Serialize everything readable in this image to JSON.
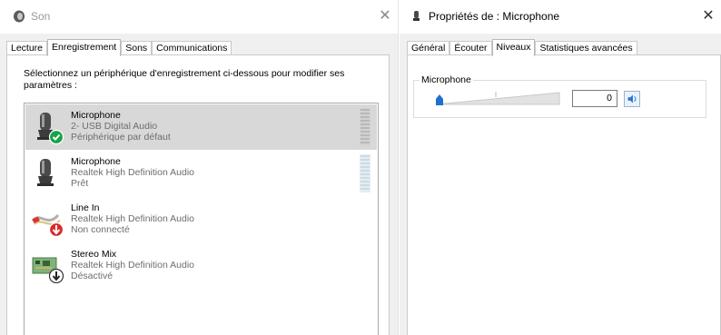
{
  "left_window": {
    "title": "Son",
    "tabs": [
      "Lecture",
      "Enregistrement",
      "Sons",
      "Communications"
    ],
    "active_tab": "Enregistrement",
    "instruction": "Sélectionnez un périphérique d'enregistrement ci-dessous pour modifier ses paramètres :",
    "devices": [
      {
        "name": "Microphone",
        "driver": "2- USB Digital Audio",
        "status": "Périphérique par défaut",
        "selected": true,
        "icon": "microphone-icon",
        "badge": "default-check-icon",
        "badge_color": "#16a34a"
      },
      {
        "name": "Microphone",
        "driver": "Realtek High Definition Audio",
        "status": "Prêt",
        "selected": false,
        "icon": "microphone-icon"
      },
      {
        "name": "Line In",
        "driver": "Realtek High Definition Audio",
        "status": "Non connecté",
        "selected": false,
        "icon": "line-in-cable-icon",
        "badge": "unplugged-arrow-icon",
        "badge_color": "#d62b2b"
      },
      {
        "name": "Stereo Mix",
        "driver": "Realtek High Definition Audio",
        "status": "Désactivé",
        "selected": false,
        "icon": "sound-card-icon",
        "badge": "disabled-arrow-icon",
        "badge_color": "#222222"
      }
    ]
  },
  "right_window": {
    "title": "Propriétés de : Microphone",
    "tabs": [
      "Général",
      "Écouter",
      "Niveaux",
      "Statistiques avancées"
    ],
    "active_tab": "Niveaux",
    "levels": {
      "group_label": "Microphone",
      "level_value": "0",
      "slider_fraction": 0
    }
  },
  "colors": {
    "accent": "#1f6fd1",
    "selection": "#d8d8d8"
  }
}
